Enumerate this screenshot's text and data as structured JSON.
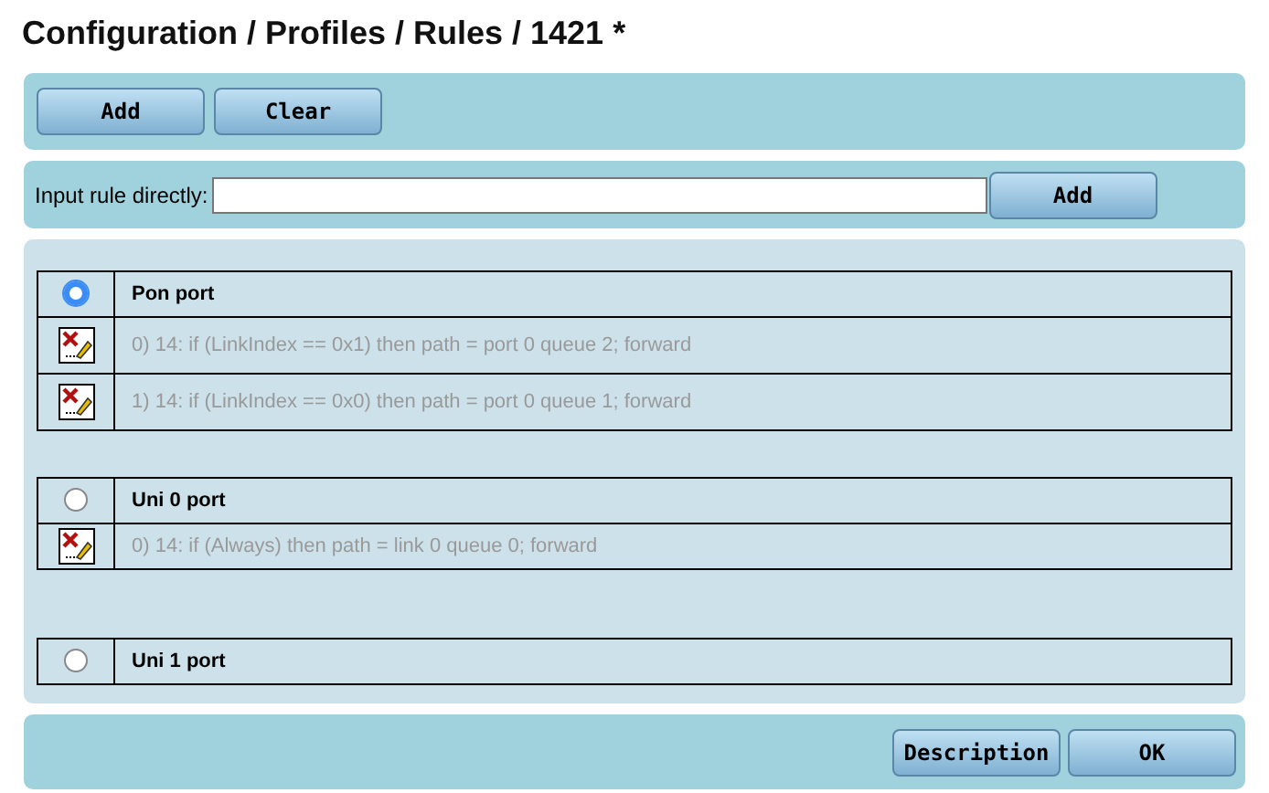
{
  "title": "Configuration / Profiles / Rules / 1421 *",
  "toolbar": {
    "buttons": [
      "Add",
      "Clear"
    ]
  },
  "direct_input": {
    "label": "Input rule directly:",
    "button": "Add"
  },
  "ports": [
    {
      "name": "Pon port",
      "selected": true,
      "rules": [
        "0) 14: if (LinkIndex == 0x1) then path = port 0 queue 2; forward",
        "1) 14: if (LinkIndex == 0x0) then path = port 0 queue 1; forward"
      ]
    },
    {
      "name": "Uni 0 port",
      "selected": false,
      "rules": [
        "0) 14: if (Always) then path = link 0 queue 0; forward"
      ]
    },
    {
      "name": "Uni 1 port",
      "selected": false
    }
  ],
  "footer": {
    "buttons": [
      "Description",
      "OK"
    ]
  }
}
